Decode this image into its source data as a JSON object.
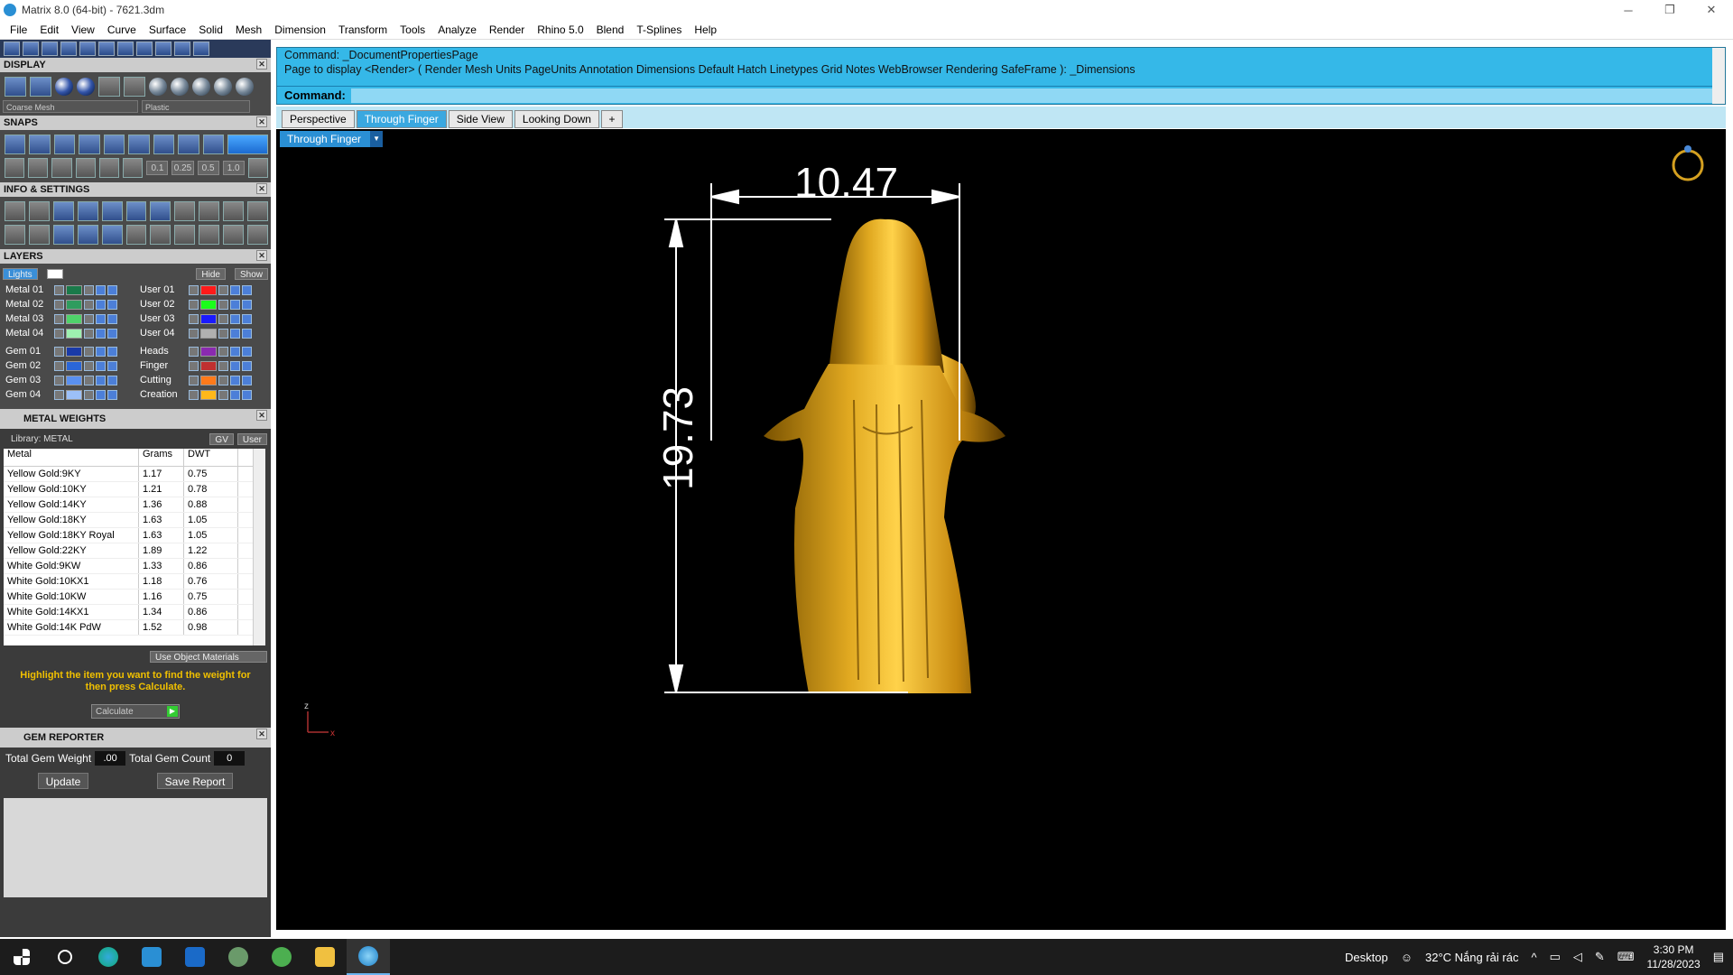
{
  "window": {
    "title": "Matrix 8.0 (64-bit) - 7621.3dm",
    "min": "─",
    "max": "❐",
    "close": "✕"
  },
  "menu": [
    "File",
    "Edit",
    "View",
    "Curve",
    "Surface",
    "Solid",
    "Mesh",
    "Dimension",
    "Transform",
    "Tools",
    "Analyze",
    "Render",
    "Rhino 5.0",
    "Blend",
    "T-Splines",
    "Help"
  ],
  "panels": {
    "display": {
      "title": "DISPLAY",
      "mesh_select": "Coarse Mesh",
      "material_select": "Plastic"
    },
    "snaps": {
      "title": "SNAPS",
      "values": [
        "0.1",
        "0.25",
        "0.5",
        "1.0"
      ]
    },
    "info": {
      "title": "INFO & SETTINGS"
    },
    "layers": {
      "title": "LAYERS",
      "lights": "Lights",
      "hide": "Hide",
      "show": "Show",
      "left": [
        {
          "name": "Metal 01",
          "color": "#1a7a4a"
        },
        {
          "name": "Metal 02",
          "color": "#2e9c5e"
        },
        {
          "name": "Metal 03",
          "color": "#4fd36a"
        },
        {
          "name": "Metal 04",
          "color": "#9ef0b0"
        },
        {
          "name": "Gem 01",
          "color": "#1a3aa8"
        },
        {
          "name": "Gem 02",
          "color": "#2a66d8"
        },
        {
          "name": "Gem 03",
          "color": "#5a90f0"
        },
        {
          "name": "Gem 04",
          "color": "#9cc0f8"
        }
      ],
      "right": [
        {
          "name": "User 01",
          "color": "#ff1a1a"
        },
        {
          "name": "User 02",
          "color": "#1aff1a"
        },
        {
          "name": "User 03",
          "color": "#1a1aff"
        },
        {
          "name": "User 04",
          "color": "#b0b0b0"
        },
        {
          "name": "Heads",
          "color": "#8a2ab0"
        },
        {
          "name": "Finger",
          "color": "#c03030"
        },
        {
          "name": "Cutting",
          "color": "#ff7a1a"
        },
        {
          "name": "Creation",
          "color": "#ffb81a"
        }
      ]
    },
    "metal_weights": {
      "title": "METAL WEIGHTS",
      "library": "Library: METAL",
      "gv": "GV",
      "user": "User",
      "columns": [
        "Metal",
        "Grams",
        "DWT"
      ],
      "rows": [
        [
          "Yellow Gold:9KY",
          "1.17",
          "0.75"
        ],
        [
          "Yellow Gold:10KY",
          "1.21",
          "0.78"
        ],
        [
          "Yellow Gold:14KY",
          "1.36",
          "0.88"
        ],
        [
          "Yellow Gold:18KY",
          "1.63",
          "1.05"
        ],
        [
          "Yellow Gold:18KY Royal",
          "1.63",
          "1.05"
        ],
        [
          "Yellow Gold:22KY",
          "1.89",
          "1.22"
        ],
        [
          "White Gold:9KW",
          "1.33",
          "0.86"
        ],
        [
          "White Gold:10KX1",
          "1.18",
          "0.76"
        ],
        [
          "White Gold:10KW",
          "1.16",
          "0.75"
        ],
        [
          "White Gold:14KX1",
          "1.34",
          "0.86"
        ],
        [
          "White Gold:14K PdW",
          "1.52",
          "0.98"
        ]
      ],
      "use_object_materials": "Use Object Materials",
      "message": "Highlight the item you want to find the weight for then press Calculate.",
      "calculate": "Calculate"
    },
    "gem_reporter": {
      "title": "GEM REPORTER",
      "total_weight_label": "Total Gem Weight",
      "total_weight": ".00",
      "total_count_label": "Total Gem Count",
      "total_count": "0",
      "update": "Update",
      "save_report": "Save Report"
    }
  },
  "command": {
    "line1": "Command: _DocumentPropertiesPage",
    "line2": "Page to display <Render> ( Render  Mesh  Units  PageUnits  Annotation  Dimensions  Default  Hatch  Linetypes  Grid  Notes  WebBrowser  Rendering  SafeFrame ): _Dimensions",
    "prompt": "Command:"
  },
  "viewport_tabs": [
    "Perspective",
    "Through Finger",
    "Side View",
    "Looking Down"
  ],
  "active_tab": "Through Finger",
  "viewport": {
    "label": "Through Finger",
    "dim_width": "10.47",
    "dim_height": "19.73",
    "axis_z": "z",
    "axis_x": "x"
  },
  "taskbar": {
    "desktop": "Desktop",
    "weather": "32°C  Nắng rải rác",
    "time": "3:30 PM",
    "date": "11/28/2023"
  }
}
